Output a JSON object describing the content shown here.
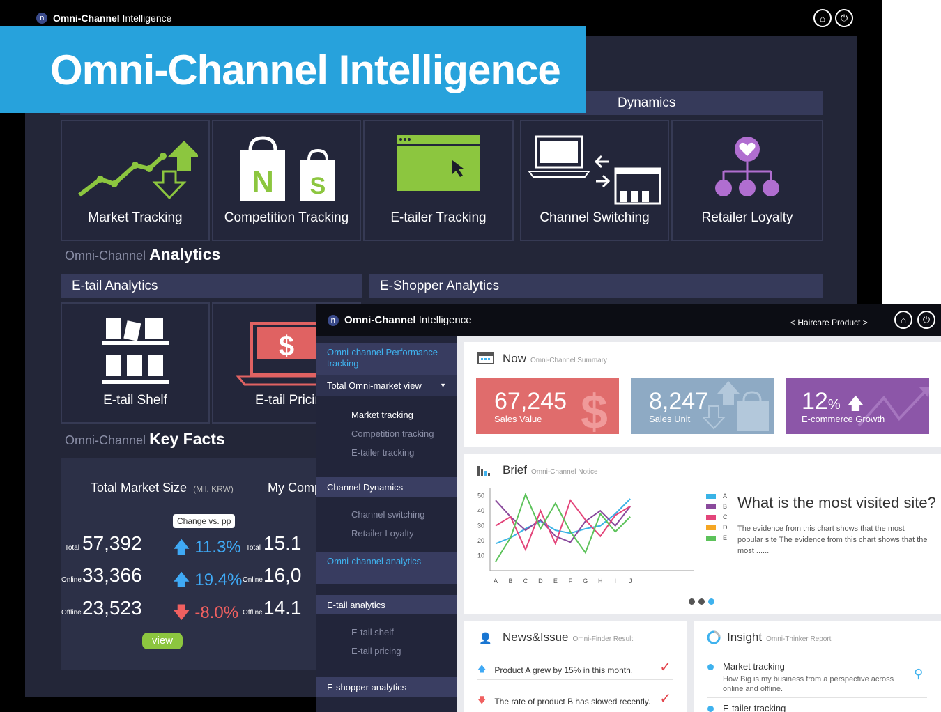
{
  "banner": {
    "title": "Omni-Channel Intelligence"
  },
  "back": {
    "brand": {
      "logo": "n",
      "bold": "Omni-Channel",
      "rest": " Intelligence"
    },
    "header_icons": [
      "home-icon",
      "power-icon"
    ],
    "top_section_partial": "Dynamics",
    "tiles": [
      {
        "label": "Market Tracking",
        "icon": "trend-arrows-icon"
      },
      {
        "label": "Competition Tracking",
        "icon": "shopping-bags-icon"
      },
      {
        "label": "E-tailer Tracking",
        "icon": "browser-cursor-icon"
      },
      {
        "label": "Channel Switching",
        "icon": "laptop-store-icon"
      },
      {
        "label": "Retailer Loyalty",
        "icon": "heart-network-icon"
      }
    ],
    "analytics": {
      "pre": "Omni-Channel ",
      "title": "Analytics"
    },
    "etail_bar": "E-tail Analytics",
    "eshopper_bar": "E-Shopper Analytics",
    "etail_tiles": [
      {
        "label": "E-tail Shelf",
        "icon": "shelf-icon"
      },
      {
        "label": "E-tail Pricing",
        "icon": "laptop-dollar-icon"
      }
    ],
    "keyfacts": {
      "pre": "Omni-Channel ",
      "title": "Key Facts"
    },
    "facts": {
      "title": "Total Market Size",
      "unit": "(Mil. KRW)",
      "change_badge": "Change vs. pp",
      "rows": [
        {
          "label": "Total",
          "value": "57,392",
          "change": "11.3%",
          "dir": "up"
        },
        {
          "label": "Online",
          "value": "33,366",
          "change": "19.4%",
          "dir": "up"
        },
        {
          "label": "Offline",
          "value": "23,523",
          "change": "-8.0%",
          "dir": "down"
        }
      ],
      "view_button": "view",
      "second_title": "My Comp",
      "second_rows": [
        {
          "label": "Total",
          "value": "15.1"
        },
        {
          "label": "Online",
          "value": "16,0"
        },
        {
          "label": "Offline",
          "value": "14.1"
        }
      ]
    }
  },
  "front": {
    "brand": {
      "logo": "n",
      "bold": "Omni-Channel",
      "rest": " Intelligence"
    },
    "breadcrumb": "< Haircare Product >",
    "header_icons": [
      "home-icon",
      "power-icon"
    ],
    "sidebar": {
      "perf_head": "Omni-channel Performance tracking",
      "total_view": "Total Omni-market view",
      "total_subs": [
        "Market tracking",
        "Competition tracking",
        "E-tailer tracking"
      ],
      "channel_dyn": "Channel Dynamics",
      "channel_subs": [
        "Channel switching",
        "Retailer Loyalty"
      ],
      "analytics_head": "Omni-channel analytics",
      "etail": "E-tail analytics",
      "etail_subs": [
        "E-tail shelf",
        "E-tail pricing"
      ],
      "eshopper": "E-shopper analytics"
    },
    "now": {
      "title": "Now",
      "subtitle": "Omni-Channel Summary",
      "kpis": [
        {
          "value": "67,245",
          "label": "Sales Value",
          "color": "#e06c6c"
        },
        {
          "value": "8,247",
          "label": "Sales Unit",
          "color": "#8eaac4"
        },
        {
          "value": "12",
          "unit": "%",
          "label": "E-commerce Growth",
          "color": "#8c56a8"
        }
      ]
    },
    "brief": {
      "title": "Brief",
      "subtitle": "Omni-Channel Notice",
      "question": "What is the most visited site?",
      "body": "The evidence from this chart shows that the most popular site The evidence from this chart shows that the most ......"
    },
    "news": {
      "title": "News&Issue",
      "subtitle": "Omni-Finder Result",
      "items": [
        {
          "text": "Product A grew by 15% in this month.",
          "dir": "up"
        },
        {
          "text": "The rate of product B has slowed recently.",
          "dir": "down"
        }
      ]
    },
    "insight": {
      "title": "Insight",
      "subtitle": "Omni-Thinker Report",
      "items": [
        {
          "title": "Market tracking",
          "desc": "How Big is my business from a perspective across online and offline."
        },
        {
          "title": "E-tailer tracking",
          "desc": ""
        }
      ]
    }
  },
  "chart_data": {
    "type": "line",
    "categories": [
      "A",
      "B",
      "C",
      "D",
      "E",
      "F",
      "G",
      "H",
      "I",
      "J"
    ],
    "yticks": [
      10,
      20,
      30,
      40,
      50
    ],
    "ylim": [
      0,
      55
    ],
    "grid": false,
    "legend_position": "right",
    "series": [
      {
        "name": "A",
        "color": "#39b3e6",
        "values": [
          18,
          22,
          28,
          33,
          27,
          25,
          28,
          30,
          38,
          48
        ]
      },
      {
        "name": "B",
        "color": "#8a4a9c",
        "values": [
          47,
          36,
          27,
          34,
          23,
          19,
          33,
          40,
          30,
          43
        ]
      },
      {
        "name": "C",
        "color": "#e3457a",
        "values": [
          30,
          36,
          14,
          40,
          18,
          47,
          34,
          23,
          37,
          43
        ]
      },
      {
        "name": "D",
        "color": "#f5a623",
        "values": []
      },
      {
        "name": "E",
        "color": "#5cc25a",
        "values": [
          6,
          22,
          51,
          28,
          45,
          26,
          12,
          38,
          26,
          36
        ]
      }
    ],
    "carousel": {
      "pages": 3,
      "active": 3
    }
  }
}
